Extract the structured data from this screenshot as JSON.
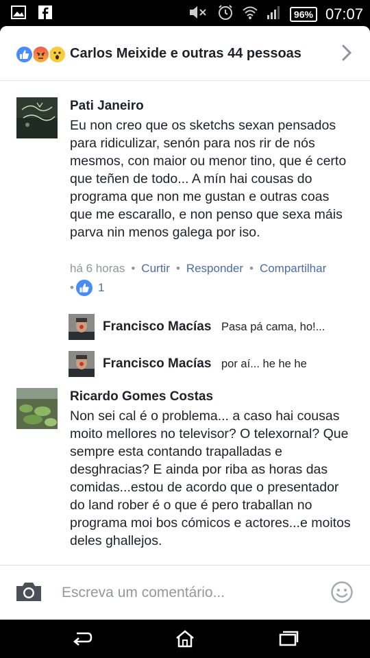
{
  "status_bar": {
    "battery": "96%",
    "time": "07:07",
    "icons": [
      "image-icon",
      "facebook-icon",
      "mute-icon",
      "alarm-icon",
      "wifi-icon",
      "signal-icon",
      "battery-icon"
    ]
  },
  "reactions": {
    "summary": "Carlos Meixide e outras 44 pessoas",
    "icons": [
      "like-reaction",
      "angry-reaction",
      "wow-reaction"
    ],
    "colors": {
      "like": "#4a8cf7",
      "angry": "#f1574d",
      "wow": "#f7cd3d"
    }
  },
  "comments": [
    {
      "author": "Pati Janeiro",
      "text": "Eu non creo que os sketchs sexan pensados para ridiculizar, senón para nos rir de nós mesmos, con maior ou menor tino, que é certo que teñen de todo... A mín hai cousas do programa que non me gustan e outras coas que me escarallo, e non penso que sexa máis parva nin menos galega por iso.",
      "time": "há 6 horas",
      "like_action": "Curtir",
      "reply_action": "Responder",
      "share_action": "Compartilhar",
      "like_count": "1",
      "replies": [
        {
          "author": "Francisco Macías",
          "text": "Pasa pá cama, ho!..."
        },
        {
          "author": "Francisco Macías",
          "text": "por aí... he he he"
        }
      ]
    },
    {
      "author": "Ricardo Gomes Costas",
      "text": "Non sei cal é o problema... a caso hai cousas moito mellores no televisor? O telexornal? Que sempre esta contando trapalladas e desghracias? E ainda por riba as horas das comidas...estou de acordo que o presentador do land rober é o que é pero traballan no programa moi bos cómicos e actores...e moitos deles ghallejos."
    }
  ],
  "composer": {
    "placeholder": "Escreva um comentário..."
  },
  "colors": {
    "link": "#4b6ba8",
    "meta": "#90949c",
    "text": "#1d2129",
    "like_blue": "#4a8cf7"
  }
}
